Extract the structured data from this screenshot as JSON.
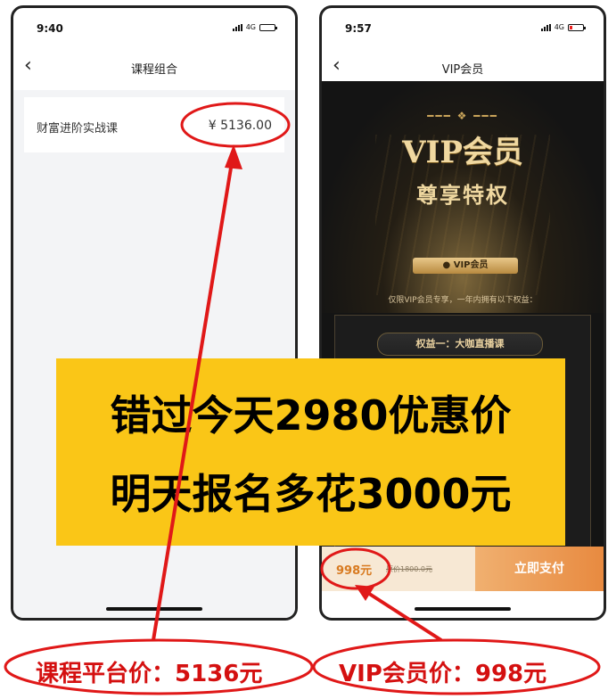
{
  "left_phone": {
    "time": "9:40",
    "network": "4G",
    "nav_title": "课程组合",
    "back_icon": "chevron-left-icon",
    "course": {
      "name": "财富进阶实战课",
      "price": "¥ 5136.00"
    }
  },
  "right_phone": {
    "time": "9:57",
    "network": "4G",
    "nav_title": "VIP会员",
    "back_icon": "chevron-left-icon",
    "vip_title": "VIP会员",
    "vip_subtitle": "尊享特权",
    "vip_badge": "● VIP会员",
    "vip_desc": "仅限VIP会员专享，一年内拥有以下权益：",
    "benefit": "权益一：大咖直播课",
    "price": "998元",
    "original_price": "原价1800.0元",
    "pay_button": "立即支付"
  },
  "banner": {
    "line1": "错过今天2980优惠价",
    "line2": "明天报名多花3000元"
  },
  "callouts": {
    "left": "课程平台价：5136元",
    "right": "VIP会员价：998元"
  },
  "colors": {
    "banner": "#fac617",
    "annotation_red": "#e01818",
    "vip_gold": "#f0d8a0",
    "pay_orange": "#e88a40"
  }
}
